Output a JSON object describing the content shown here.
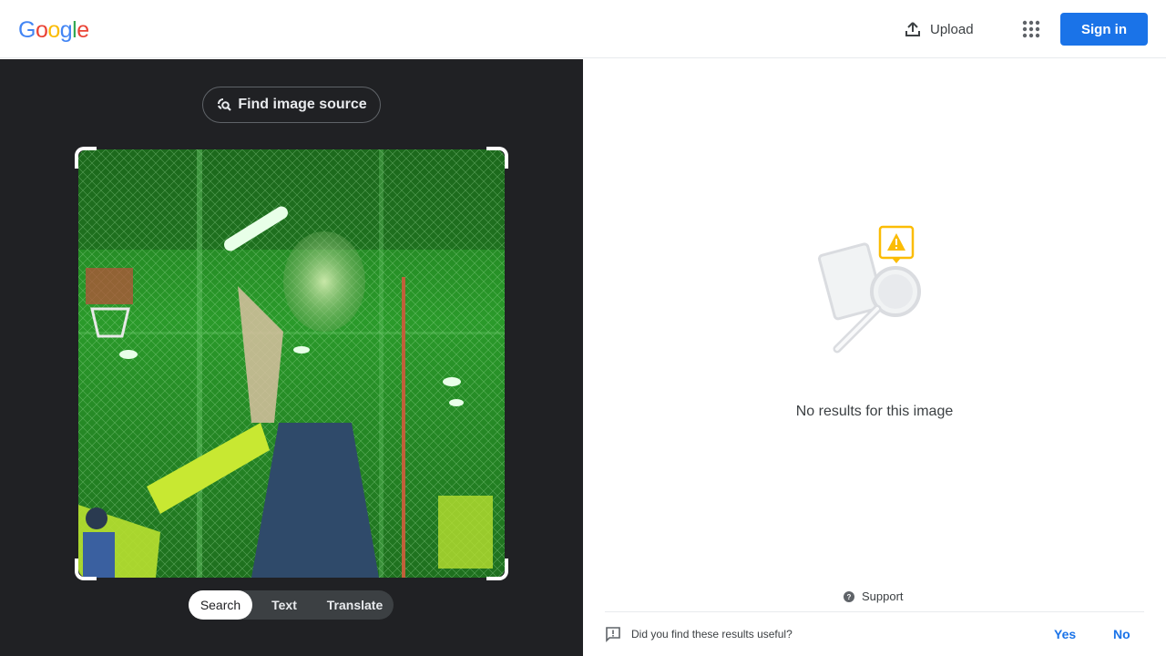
{
  "header": {
    "logo_letters": [
      "G",
      "o",
      "o",
      "g",
      "l",
      "e"
    ],
    "logo_colors": [
      "#4285f4",
      "#ea4335",
      "#fbbc05",
      "#4285f4",
      "#34a853",
      "#ea4335"
    ],
    "upload_label": "Upload",
    "upload_icon": "upload-icon",
    "apps_icon": "apps-grid-icon",
    "signin_label": "Sign in"
  },
  "lens": {
    "find_source_label": "Find image source",
    "find_source_icon": "lens-search-icon",
    "image_description": "photo-blurry-basketball-court-green",
    "modes": [
      {
        "label": "Search",
        "active": true
      },
      {
        "label": "Text",
        "active": false
      },
      {
        "label": "Translate",
        "active": false
      }
    ]
  },
  "results": {
    "empty_icon": "no-results-illustration",
    "empty_message": "No results for this image",
    "support_label": "Support",
    "support_icon": "help-circle-icon",
    "feedback_question": "Did you find these results useful?",
    "feedback_icon": "feedback-icon",
    "yes_label": "Yes",
    "no_label": "No"
  },
  "colors": {
    "accent": "#1a73e8",
    "dark_panel": "#202124",
    "warning": "#fbbc04"
  }
}
